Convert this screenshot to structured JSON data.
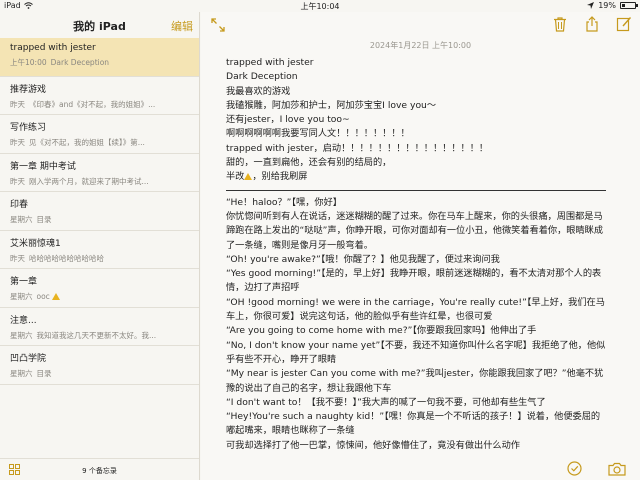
{
  "status_bar": {
    "carrier": "iPad",
    "time": "上午10:04",
    "battery": "19%"
  },
  "sidebar": {
    "title": "我的 iPad",
    "edit_label": "编辑",
    "footer_count": "9 个备忘录",
    "notes": [
      {
        "title": "trapped with jester",
        "date": "上午10:00",
        "preview": "Dark Deception",
        "warn": false
      },
      {
        "title": "推荐游戏",
        "date": "昨天",
        "preview": "《印春》and《对不起，我的姐姐》...",
        "warn": false
      },
      {
        "title": "写作练习",
        "date": "昨天",
        "preview": "见《对不起，我的姐姐【续】》第...",
        "warn": false
      },
      {
        "title": "第一章 期中考试",
        "date": "昨天",
        "preview": "刚入学两个月，就迎来了期中考试...",
        "warn": false
      },
      {
        "title": "印春",
        "date": "星期六",
        "preview": "目录",
        "warn": false
      },
      {
        "title": "艾米丽惊魂1",
        "date": "昨天",
        "preview": "哈哈哈哈哈哈哈哈哈哈",
        "warn": false
      },
      {
        "title": "第一章",
        "date": "星期六",
        "preview": "ooc",
        "warn": true
      },
      {
        "title": "注意...",
        "date": "星期六",
        "preview": "我知道我这几天不更新不太好。我...",
        "warn": false
      },
      {
        "title": "凹凸学院",
        "date": "星期六",
        "preview": "目录",
        "warn": false
      }
    ]
  },
  "detail": {
    "date": "2024年1月22日 上午10:00",
    "header_lines": [
      "trapped with jester",
      "Dark Deception",
      "我最喜欢的游戏",
      "我磕猴雕，阿加莎和护士，阿加莎宝宝I love you～",
      "还有jester，I love you too~",
      "啊啊啊啊啊啊我要写同人文！！！！！！！！",
      "trapped with jester，启动！！！！！！！！！！！！！！！！",
      "甜的，一直到扁他，还会有别的结局的，"
    ],
    "warn_line_before": "半改",
    "warn_line_after": "，别给我刷屏",
    "body_lines": [
      "“He！haloo？”【嘿，你好】",
      "你忧惚间听到有人在说话，迷迷糊糊的醒了过来。你在马车上醒来，你的头很痛，周围都是马蹄跑在路上发出的“哒哒”声，你睁开眼，可你对面却有一位小丑，他微笑着看着你，眼睛眯成了一条缝，嘴则是像月牙一般弯着。",
      "“Oh! you're awake?”【哦！你醒了？】他见我醒了，便过来询问我",
      "“Yes good morning!”【是的，早上好】我睁开眼，眼前迷迷糊糊的，看不太清对那个人的表情，边打了声招呼",
      "“OH !good morning! we were in the carriage，You're really cute!”【早上好，我们在马车上，你很可爱】说完这句话，他的脸似乎有些许红晕，也很可爱",
      "“Are you going to come home with me?”【你要跟我回家吗】他伸出了手",
      "“No, I don't know your name yet”【不要，我还不知道你叫什么名字呢】我拒绝了他，他似乎有些不开心，睁开了眼睛",
      "“My near is jester Can you come with me?”我叫jester，你能跟我回家了吧？”他毫不犹豫的说出了自己的名字，想让我跟他下车",
      "“I don't want to！【我不要！】”我大声的喊了一句我不要，可他却有些生气了",
      "“Hey!You're such a naughty kid！”【嘿！你真是一个不听话的孩子！】说着，他便委屈的嘟起嘴来，眼睛也眯称了一条缝",
      "可我却选择打了他一巴掌，惊悚间，他好像懵住了，竟没有做出什么动作"
    ]
  }
}
